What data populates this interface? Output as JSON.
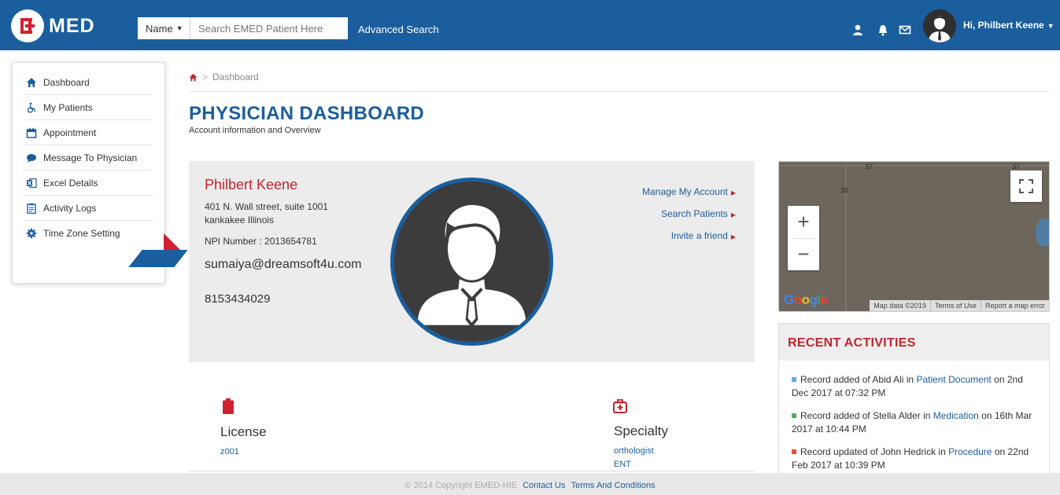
{
  "header": {
    "logo_text": "MED",
    "search_type": "Name",
    "search_placeholder": "Search EMED Patient Here",
    "advanced_search": "Advanced Search",
    "user_greeting": "Hi, Philbert Keene",
    "icons": [
      "user-icon",
      "bell-icon",
      "envelope-icon"
    ],
    "brand_color": "#1b5e9e",
    "accent_color": "#c0262d"
  },
  "sidebar": {
    "items": [
      {
        "label": "Dashboard",
        "icon": "home-icon"
      },
      {
        "label": "My Patients",
        "icon": "wheelchair-icon"
      },
      {
        "label": "Appointment",
        "icon": "calendar-icon"
      },
      {
        "label": "Message To Physician",
        "icon": "chat-icon"
      },
      {
        "label": "Excel Details",
        "icon": "excel-icon"
      },
      {
        "label": "Activity Logs",
        "icon": "clipboard-icon"
      },
      {
        "label": "Time Zone Setting",
        "icon": "gear-icon"
      }
    ]
  },
  "breadcrumb": {
    "current": "Dashboard"
  },
  "page": {
    "title": "PHYSICIAN DASHBOARD",
    "subtitle": "Account information and Overview"
  },
  "profile": {
    "name": "Philbert Keene",
    "address_line1": "401 N. Wall street, suite 1001",
    "address_line2": "kankakee Illinois",
    "npi": "NPI Number : 2013654781",
    "email": "sumaiya@dreamsoft4u.com",
    "phone": "8153434029",
    "links": [
      "Manage My Account",
      "Search Patients",
      "Invite a friend"
    ]
  },
  "license": {
    "title": "License",
    "value": "z001"
  },
  "specialty": {
    "title": "Specialty",
    "values": [
      "orthologist",
      "ENT"
    ]
  },
  "map": {
    "labels": [
      "57",
      "57",
      "20"
    ],
    "google": "Google",
    "attribution": [
      "Map data ©2019",
      "Terms of Use",
      "Report a map error"
    ]
  },
  "recent": {
    "title": "RECENT ACTIVITIES",
    "items": [
      {
        "prefix": "Record added of Abid Ali in ",
        "link": "Patient Document",
        "suffix": " on 2nd Dec 2017 at 07:32 PM",
        "color": "#5aaee0"
      },
      {
        "prefix": "Record added of Stella Alder in ",
        "link": "Medication",
        "suffix": " on 16th Mar 2017 at 10:44 PM",
        "color": "#4caf50"
      },
      {
        "prefix": "Record updated of John Hedrick in ",
        "link": "Procedure",
        "suffix": " on 22nd Feb 2017 at 10:39 PM",
        "color": "#e8542e"
      }
    ]
  },
  "footer": {
    "copyright": "© 2014 Copyright EMED-HIE",
    "contact": "Contact Us",
    "terms": "Terms And Conditions"
  }
}
